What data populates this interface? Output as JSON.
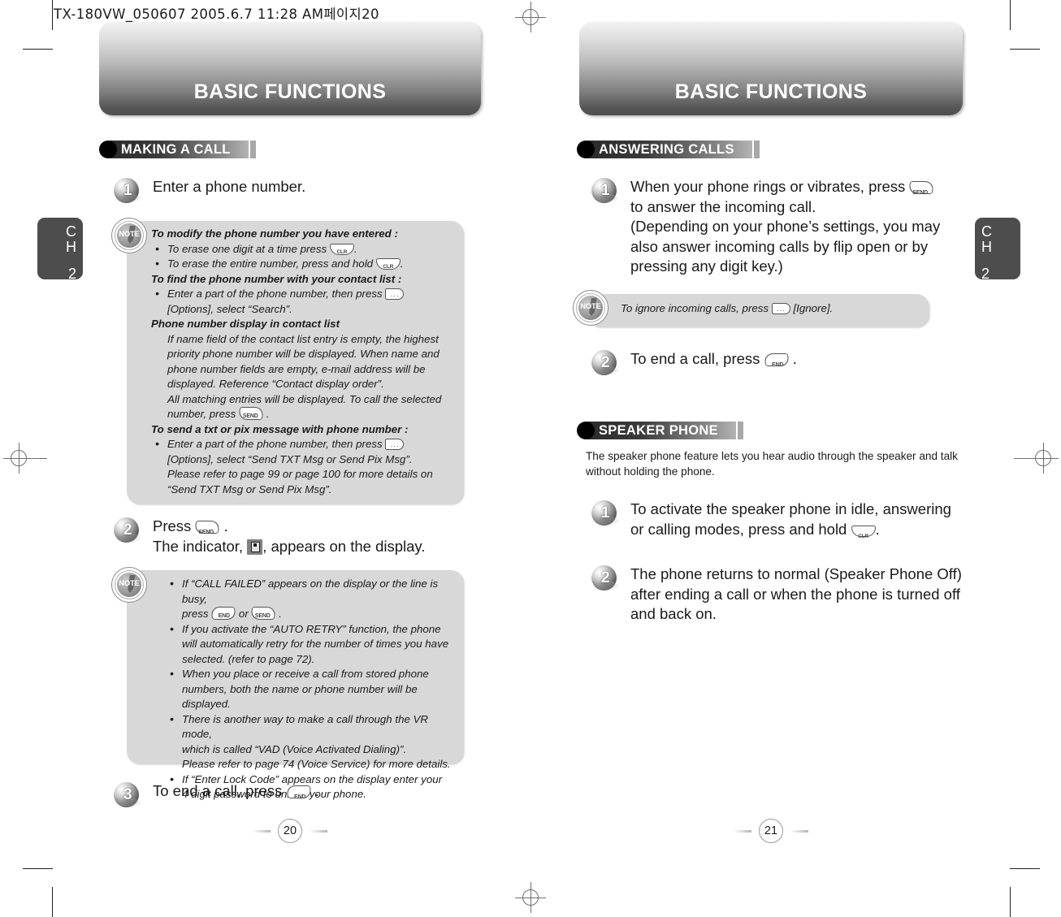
{
  "print_stamp": "TX-180VW_050607  2005.6.7 11:28 AM페이지20",
  "left_page": {
    "banner_title": "BASIC FUNCTIONS",
    "chapter_tab": {
      "ch": "C\nH",
      "line1": "C",
      "line2": "H",
      "num": "2"
    },
    "page_number": "20",
    "section": {
      "title": "MAKING A CALL",
      "steps": [
        {
          "num": "1",
          "text": "Enter a phone number."
        },
        {
          "num": "2",
          "line1_pre": "Press",
          "line1_post": ".",
          "line2_pre": "The indicator,",
          "line2_post": ", appears on the display."
        },
        {
          "num": "3",
          "pre": "To end a call, press",
          "post": "."
        }
      ]
    },
    "note1": {
      "heading1": "To modify the phone number you have entered :",
      "bullet1_pre": "To erase one digit at a time press",
      "bullet1_post": ".",
      "bullet2_pre": "To erase the entire number, press and hold",
      "bullet2_post": ".",
      "heading2": "To find the phone number with your contact list :",
      "bullet3_pre": "Enter a part of the phone number, then press",
      "bullet3_line2": "[Options], select “Search”.",
      "heading3": "Phone number display in contact list",
      "para1": "If name field of the contact list entry is empty, the highest priority phone number will be displayed.  When name and phone number fields are empty, e-mail address will be displayed.  Reference “Contact display order”.",
      "para2_pre": "All matching entries will be displayed. To call the selected number, press",
      "para2_post": ".",
      "heading4": "To send a txt or pix message with phone number :",
      "bullet4_pre": "Enter a part of the  phone number, then press",
      "bullet4_line2": "[Options], select “Send TXT Msg or Send Pix Msg”.",
      "bullet4_line3": "Please refer to page 99 or page 100 for more details on",
      "bullet4_line4": "“Send TXT Msg or Send Pix Msg”."
    },
    "note2": {
      "bullet1_line1": "If “CALL FAILED” appears on the display or the line is busy,",
      "bullet1_line2_pre": "press",
      "bullet1_line2_mid": "or",
      "bullet1_line2_post": ".",
      "bullet2": "If you activate the “AUTO RETRY” function, the phone will automatically retry for the number of times you have selected. (refer to page 72).",
      "bullet3": "When you place or receive a call from stored phone numbers, both the name or phone number will be displayed.",
      "bullet4_line1": "There is another way to make a call through the VR mode,",
      "bullet4_line2": "which is called “VAD (Voice Activated Dialing)”.",
      "bullet4_line3": "Please refer to page 74 (Voice Service) for more details.",
      "bullet5_line1": "If “Enter Lock Code” appears on the display enter your",
      "bullet5_line2": "4 digit password to unlock your phone."
    }
  },
  "right_page": {
    "banner_title": "BASIC FUNCTIONS",
    "chapter_tab": {
      "line1": "C",
      "line2": "H",
      "num": "2"
    },
    "page_number": "21",
    "section_answering": {
      "title": "ANSWERING CALLS",
      "step1": {
        "num": "1",
        "line1_pre": "When your phone rings or vibrates, press",
        "line2": "to answer the incoming call.",
        "line3": "(Depending on your phone’s settings, you may",
        "line4": "also answer incoming calls by flip open or by",
        "line5": "pressing any digit key.)"
      },
      "note": {
        "pre": "To ignore incoming calls, press",
        "post": "[Ignore]."
      },
      "step2": {
        "num": "2",
        "pre": "To end a call, press",
        "post": "."
      }
    },
    "section_speaker": {
      "title": "SPEAKER PHONE",
      "intro": "The speaker phone feature lets you hear audio through the speaker and talk without holding the phone.",
      "step1": {
        "num": "1",
        "line1": "To activate the speaker phone in idle, answering",
        "line2_pre": "or calling modes, press and hold",
        "line2_post": "."
      },
      "step2": {
        "num": "2",
        "line1": "The phone returns to normal (Speaker Phone Off)",
        "line2": "after ending a call or when the phone is turned off",
        "line3": "and back on."
      }
    }
  },
  "keys": {
    "send": "SEND",
    "end": "END",
    "clr": "CLR",
    "soft": "···"
  },
  "colors": {
    "note_bg": "#d8d8d8",
    "tab_bg": "#4d4d4d",
    "banner_dark": "#4e4e4e",
    "banner_light": "#f2f2f2"
  }
}
